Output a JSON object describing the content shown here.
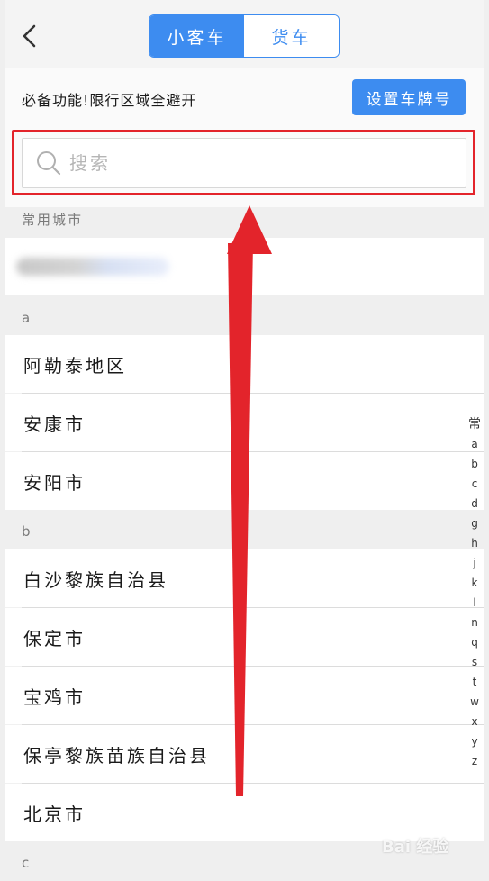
{
  "header": {
    "tabs": [
      {
        "label": "小客车",
        "active": true
      },
      {
        "label": "货车",
        "active": false
      }
    ]
  },
  "promo": {
    "text": "必备功能!限行区域全避开",
    "button_label": "设置车牌号"
  },
  "search": {
    "placeholder": "搜索",
    "value": ""
  },
  "sections": {
    "frequent_label": "常用城市",
    "a_label": "a",
    "b_label": "b",
    "c_label": "c"
  },
  "cities": {
    "a": [
      "阿勒泰地区",
      "安康市",
      "安阳市"
    ],
    "b": [
      "白沙黎族自治县",
      "保定市",
      "宝鸡市",
      "保亭黎族苗族自治县",
      "北京市"
    ]
  },
  "index_bar": [
    "常",
    "a",
    "b",
    "c",
    "d",
    "g",
    "h",
    "j",
    "k",
    "l",
    "n",
    "q",
    "s",
    "t",
    "w",
    "x",
    "y",
    "z"
  ],
  "watermark": "Bai 经验",
  "colors": {
    "accent": "#3d8cf0",
    "annotation_red": "#e3242b"
  }
}
